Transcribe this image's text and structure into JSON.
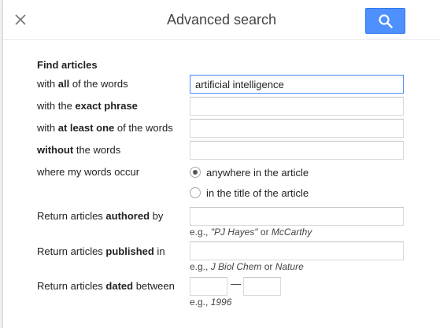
{
  "dialog": {
    "title": "Advanced search",
    "close_icon": "close-icon",
    "search_icon": "search-icon"
  },
  "form": {
    "section_title": "Find articles",
    "all_words": {
      "label_pre": "with ",
      "label_bold": "all",
      "label_post": " of the words",
      "value": "artificial intelligence",
      "placeholder": ""
    },
    "exact_phrase": {
      "label_pre": "with the ",
      "label_bold": "exact phrase",
      "label_post": "",
      "value": "",
      "placeholder": ""
    },
    "at_least_one": {
      "label_pre": "with ",
      "label_bold": "at least one",
      "label_post": " of the words",
      "value": "",
      "placeholder": ""
    },
    "without": {
      "label_pre": "",
      "label_bold": "without",
      "label_post": " the words",
      "value": "",
      "placeholder": ""
    },
    "occurrence": {
      "label": "where my words occur",
      "options": [
        {
          "label": "anywhere in the article",
          "checked": true
        },
        {
          "label": "in the title of the article",
          "checked": false
        }
      ]
    },
    "authored": {
      "label_pre": "Return articles ",
      "label_bold": "authored",
      "label_post": " by",
      "value": "",
      "hint_pre": "e.g., ",
      "hint_ex1": "\"PJ Hayes\"",
      "hint_mid": " or ",
      "hint_ex2": "McCarthy"
    },
    "published": {
      "label_pre": "Return articles ",
      "label_bold": "published",
      "label_post": " in",
      "value": "",
      "hint_pre": "e.g., ",
      "hint_ex1": "J Biol Chem",
      "hint_mid": " or ",
      "hint_ex2": "Nature"
    },
    "dated": {
      "label_pre": "Return articles ",
      "label_bold": "dated",
      "label_post": " between",
      "from_value": "",
      "to_value": "",
      "separator": "—",
      "hint_pre": "e.g., ",
      "hint_ex1": "1996"
    }
  },
  "colors": {
    "accent": "#4d90fe",
    "focus_border": "#4d90fe"
  }
}
